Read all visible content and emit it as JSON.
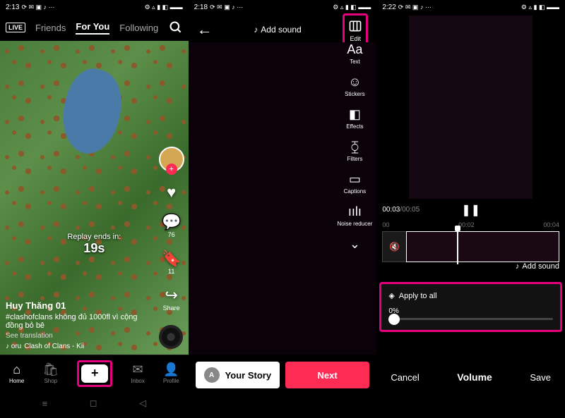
{
  "phone1": {
    "status": {
      "time": "2:13",
      "icons_left": "⟳ ✉ ▣ ♪ ⋯",
      "icons_right": "⚙ ▵ ▮ ◧ ▬▬"
    },
    "topnav": {
      "live": "LIVE",
      "friends": "Friends",
      "foryou": "For You",
      "following": "Following"
    },
    "rail": {
      "like_count": "",
      "comment_count": "76",
      "bookmark_count": "11",
      "share_label": "Share"
    },
    "replay": {
      "label": "Replay ends in:",
      "time": "19s"
    },
    "feed": {
      "user": "Huy Thăng 01",
      "caption": "#clashofclans không đủ 1000fl vì cộng đồng bỏ bê",
      "translate": "See translation",
      "music_prefix": "♪ oru",
      "music": "Clash of Clans - Kii"
    },
    "nav": {
      "home": "Home",
      "shop": "Shop",
      "inbox": "Inbox",
      "profile": "Profile"
    }
  },
  "phone2": {
    "status": {
      "time": "2:18",
      "icons_left": "⟳ ✉ ▣ ♪ ⋯",
      "icons_right": "⚙ ▵ ▮ ◧ ▬▬"
    },
    "add_sound": "Add sound",
    "edit": "Edit",
    "tools": {
      "text": "Text",
      "stickers": "Stickers",
      "effects": "Effects",
      "filters": "Filters",
      "captions": "Captions",
      "noise": "Noise reducer"
    },
    "your_story": "Your Story",
    "story_initial": "A",
    "next": "Next"
  },
  "phone3": {
    "status": {
      "time": "2:22",
      "icons_left": "⟳ ✉ ▣ ♪ ⋯",
      "icons_right": "⚙ ▵ ▮ ◧ ▬▬"
    },
    "time_current": "00:03",
    "time_total": "/00:05",
    "ticks": {
      "t0": "00",
      "t1": "00:02",
      "t2": "00:04"
    },
    "add_sound": "Add sound",
    "apply_all": "Apply to all",
    "vol_value": "0%",
    "cancel": "Cancel",
    "volume": "Volume",
    "save": "Save"
  }
}
